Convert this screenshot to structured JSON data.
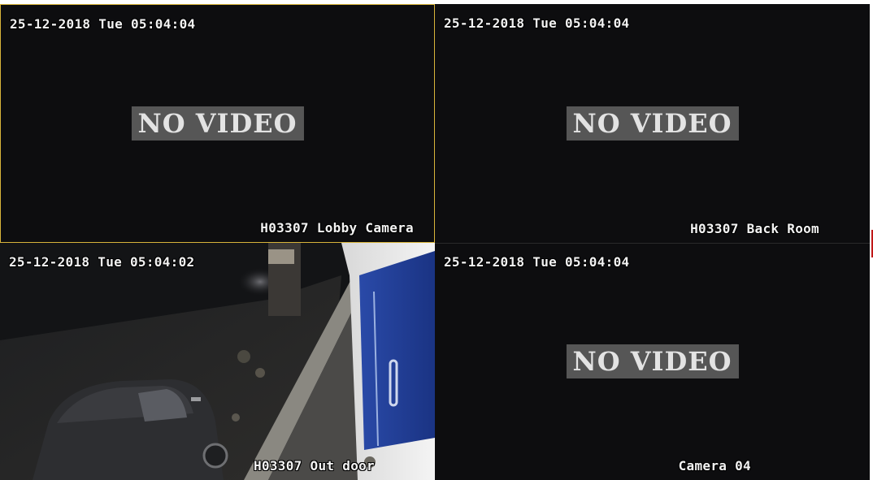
{
  "cameras": [
    {
      "timestamp": "25-12-2018 Tue 05:04:04",
      "name": "H03307 Lobby Camera",
      "status": "NO VIDEO",
      "selected": true
    },
    {
      "timestamp": "25-12-2018 Tue 05:04:04",
      "name": "H03307 Back Room",
      "status": "NO VIDEO",
      "selected": false
    },
    {
      "timestamp": "25-12-2018 Tue 05:04:02",
      "name": "H03307 Out door",
      "status": "",
      "selected": false
    },
    {
      "timestamp": "25-12-2018 Tue 05:04:04",
      "name": "Camera 04",
      "status": "NO VIDEO",
      "selected": false
    }
  ],
  "colors": {
    "selected_border": "#d8b43a",
    "tile_background": "#0d0d0f",
    "no_video_badge": "#565656"
  }
}
